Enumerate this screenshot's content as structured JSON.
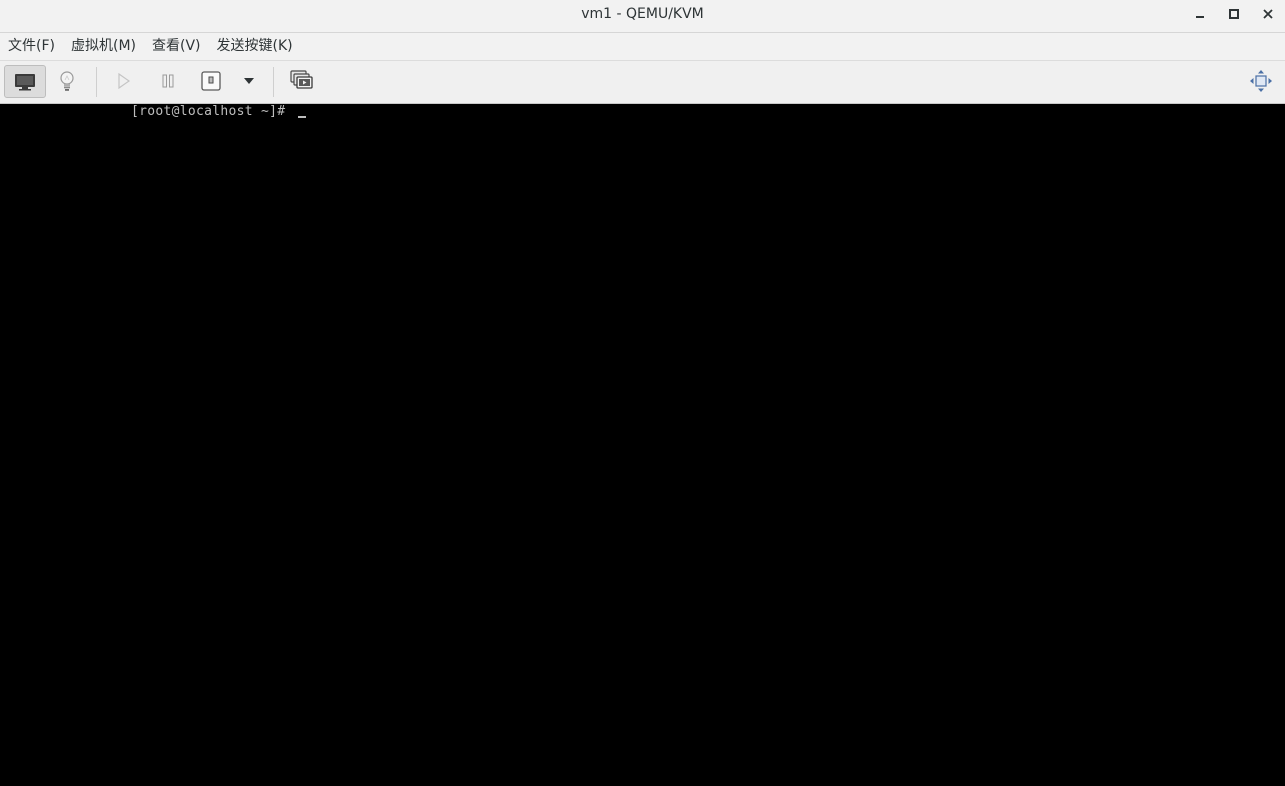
{
  "window": {
    "title": "vm1 - QEMU/KVM",
    "controls": [
      "minimize-icon",
      "maximize-icon",
      "close-icon"
    ]
  },
  "menubar": {
    "items": [
      {
        "label": "文件(F)"
      },
      {
        "label": "虚拟机(M)"
      },
      {
        "label": "查看(V)"
      },
      {
        "label": "发送按键(K)"
      }
    ]
  },
  "toolbar": {
    "buttons": [
      {
        "icon": "monitor-icon",
        "active": true
      },
      {
        "icon": "lightbulb-icon",
        "active": false
      },
      {
        "icon": "play-icon",
        "active": false,
        "disabled": true
      },
      {
        "icon": "pause-icon",
        "active": false,
        "disabled": true
      },
      {
        "icon": "power-icon",
        "active": false
      },
      {
        "icon": "dropdown-arrow-icon",
        "active": false
      },
      {
        "icon": "screenshots-icon",
        "active": false
      },
      {
        "icon": "fullscreen-icon",
        "active": false
      }
    ]
  },
  "console": {
    "prompt": "[root@localhost ~]# ",
    "colors": {
      "background": "#000000",
      "text": "#bdbdbd"
    }
  }
}
